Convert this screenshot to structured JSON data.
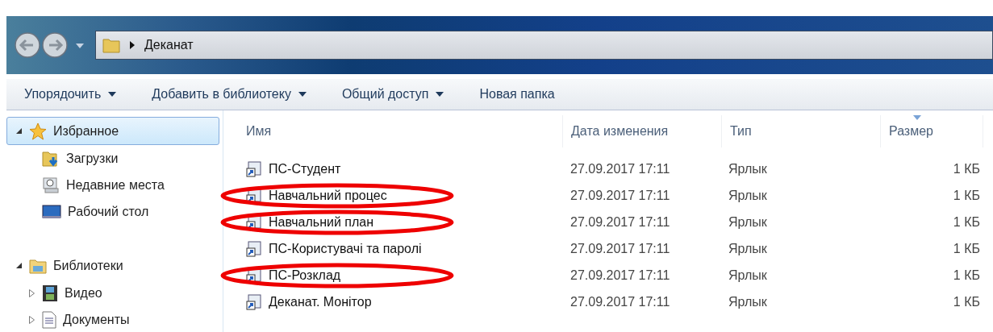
{
  "address_bar": {
    "path": [
      "Деканат"
    ]
  },
  "toolbar": [
    {
      "label": "Упорядочить",
      "dropdown": true
    },
    {
      "label": "Добавить в библиотеку",
      "dropdown": true
    },
    {
      "label": "Общий доступ",
      "dropdown": true
    },
    {
      "label": "Новая папка",
      "dropdown": false
    }
  ],
  "sidebar": {
    "groups": [
      {
        "label": "Избранное",
        "expanded": true,
        "selected": true,
        "children": [
          {
            "label": "Загрузки"
          },
          {
            "label": "Недавние места"
          },
          {
            "label": "Рабочий стол"
          }
        ]
      },
      {
        "label": "Библиотеки",
        "expanded": true,
        "selected": false,
        "children": [
          {
            "label": "Видео",
            "expanded": false
          },
          {
            "label": "Документы",
            "expanded": false
          }
        ]
      }
    ]
  },
  "table": {
    "columns": [
      {
        "label": "Имя",
        "sorted": false
      },
      {
        "label": "Дата изменения",
        "sorted": false
      },
      {
        "label": "Тип",
        "sorted": false
      },
      {
        "label": "Размер",
        "sorted": true
      }
    ],
    "rows": [
      {
        "name": "ПС-Студент",
        "date": "27.09.2017 17:11",
        "type": "Ярлык",
        "size": "1 КБ",
        "circled": false
      },
      {
        "name": "Навчальний процес",
        "date": "27.09.2017 17:11",
        "type": "Ярлык",
        "size": "1 КБ",
        "circled": true
      },
      {
        "name": "Навчальний план",
        "date": "27.09.2017 17:11",
        "type": "Ярлык",
        "size": "1 КБ",
        "circled": true
      },
      {
        "name": "ПС-Користувачі та паролі",
        "date": "27.09.2017 17:11",
        "type": "Ярлык",
        "size": "1 КБ",
        "circled": false
      },
      {
        "name": "ПС-Розклад",
        "date": "27.09.2017 17:11",
        "type": "Ярлык",
        "size": "1 КБ",
        "circled": true
      },
      {
        "name": "Деканат. Монітор",
        "date": "27.09.2017 17:11",
        "type": "Ярлык",
        "size": "1 КБ",
        "circled": false
      }
    ]
  }
}
